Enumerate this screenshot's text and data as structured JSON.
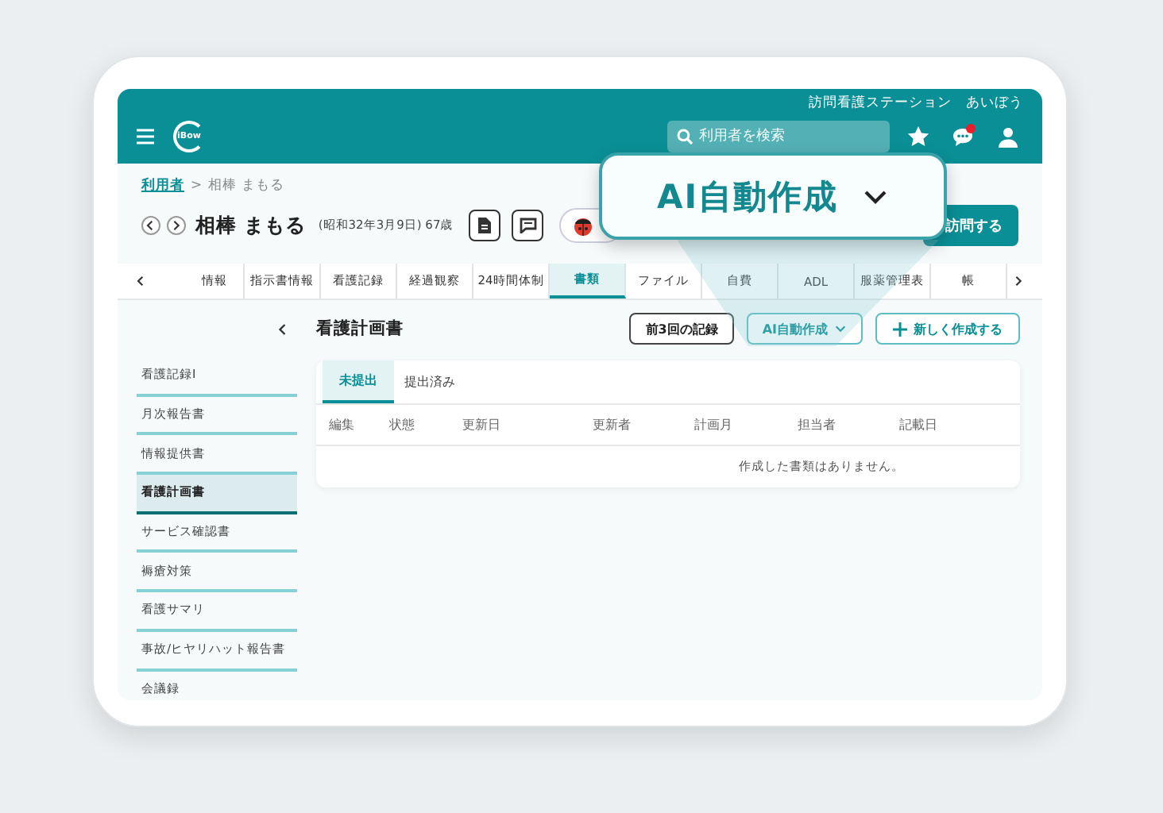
{
  "header": {
    "station": "訪問看護ステーション　あいぼう",
    "logo": "iBow",
    "search": {
      "placeholder": "利用者を検索"
    },
    "chat_unread": true
  },
  "breadcrumb": {
    "items": [
      {
        "label": "利用者",
        "link": true
      },
      {
        "label": "相棒 まもる",
        "link": false
      }
    ],
    "separator": ">"
  },
  "patient": {
    "name": "相棒 まもる",
    "birth": "(昭和32年3月9日) 67歳",
    "visit_button": "訪問する"
  },
  "nav_tabs": [
    {
      "label": "情報",
      "selected": false
    },
    {
      "label": "指示書情報",
      "selected": false
    },
    {
      "label": "看護記録",
      "selected": false
    },
    {
      "label": "経過観察",
      "selected": false
    },
    {
      "label": "24時間体制",
      "selected": false
    },
    {
      "label": "書類",
      "selected": true
    },
    {
      "label": "ファイル",
      "selected": false
    },
    {
      "label": "自費",
      "selected": false
    },
    {
      "label": "ADL",
      "selected": false
    },
    {
      "label": "服薬管理表",
      "selected": false
    },
    {
      "label": "帳",
      "selected": false
    }
  ],
  "sidebar": {
    "items": [
      {
        "label": "看護記録Ⅰ",
        "selected": false
      },
      {
        "label": "月次報告書",
        "selected": false
      },
      {
        "label": "情報提供書",
        "selected": false
      },
      {
        "label": "看護計画書",
        "selected": true
      },
      {
        "label": "サービス確認書",
        "selected": false
      },
      {
        "label": "褥瘡対策",
        "selected": false
      },
      {
        "label": "看護サマリ",
        "selected": false
      },
      {
        "label": "事故/ヒヤリハット報告書",
        "selected": false
      },
      {
        "label": "会議録",
        "selected": false
      }
    ]
  },
  "document": {
    "title": "看護計画書",
    "buttons": [
      {
        "label": "前3回の記録",
        "kind": "outline"
      },
      {
        "label": "AI自動作成",
        "kind": "dropdown"
      },
      {
        "label": "新しく作成する",
        "kind": "create"
      }
    ],
    "tabs": [
      {
        "label": "未提出",
        "selected": true
      },
      {
        "label": "提出済み",
        "selected": false
      }
    ],
    "columns": [
      "編集",
      "状態",
      "更新日",
      "更新者",
      "計画月",
      "担当者",
      "記載日"
    ],
    "empty_message": "作成した書類はありません。"
  },
  "callout": {
    "label": "AI自動作成"
  }
}
